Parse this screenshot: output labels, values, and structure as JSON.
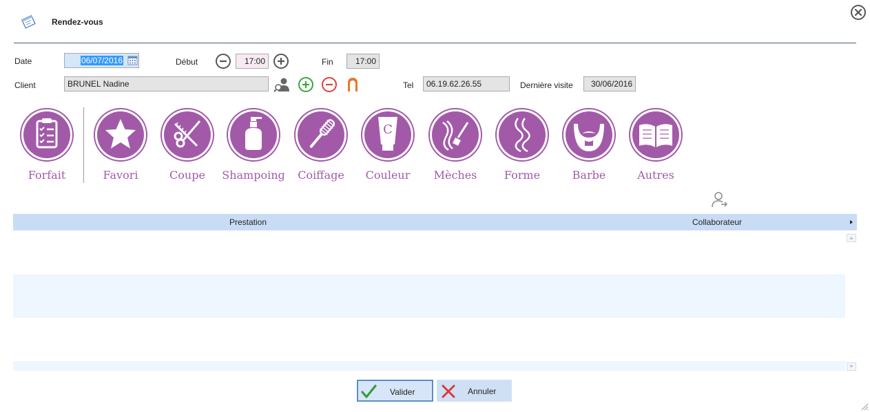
{
  "window": {
    "title": "Rendez-vous"
  },
  "form": {
    "date_label": "Date",
    "date_value": "06/07/2016",
    "debut_label": "Début",
    "debut_value": "17:00",
    "fin_label": "Fin",
    "fin_value": "17:00",
    "client_label": "Client",
    "client_value": "BRUNEL Nadine",
    "tel_label": "Tel",
    "tel_value": "06.19.62.26.55",
    "derniere_visite_label": "Dernière visite",
    "derniere_visite_value": "30/06/2016"
  },
  "categories": [
    {
      "label": "Forfait",
      "icon": "clipboard-checklist-icon"
    },
    {
      "label": "Favori",
      "icon": "star-icon"
    },
    {
      "label": "Coupe",
      "icon": "scissors-comb-icon"
    },
    {
      "label": "Shampoing",
      "icon": "shampoo-bottle-icon"
    },
    {
      "label": "Coiffage",
      "icon": "hairbrush-icon"
    },
    {
      "label": "Couleur",
      "icon": "color-tube-icon"
    },
    {
      "label": "Mèches",
      "icon": "highlight-brush-icon"
    },
    {
      "label": "Forme",
      "icon": "curl-icon"
    },
    {
      "label": "Barbe",
      "icon": "beard-icon"
    },
    {
      "label": "Autres",
      "icon": "book-icon"
    }
  ],
  "grid": {
    "columns": [
      "Prestation",
      "Collaborateur"
    ],
    "rows": []
  },
  "actions": {
    "ok_label": "Valider",
    "cancel_label": "Annuler"
  },
  "colors": {
    "accent_purple": "#a25aa8",
    "grid_header": "#c9dcf5",
    "ok_green": "#3a9a3a",
    "cancel_red": "#d83a3a",
    "add_green": "#3aa63a",
    "remove_red": "#e0403a",
    "orange": "#e8772a"
  }
}
